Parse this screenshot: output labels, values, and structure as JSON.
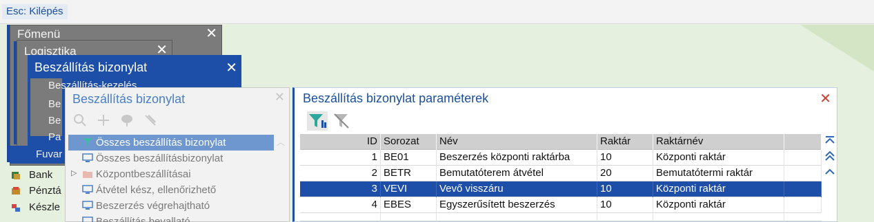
{
  "topbar": {
    "esc_label": "Esc: Kilépés"
  },
  "main_menu": {
    "title": "Főmenü"
  },
  "logistics_menu": {
    "title": "Logisztika"
  },
  "beszall_menu": {
    "title": "Beszállítás bizonylat",
    "items": [
      "Beszállítás-kezelés",
      "Be",
      "Be",
      "Pa"
    ]
  },
  "left_nav": {
    "fuvar_label": "Fuvar",
    "items": [
      {
        "label": "Bank",
        "icon": "bank-icon"
      },
      {
        "label": "Pénztá",
        "icon": "cash-icon"
      },
      {
        "label": "Készle",
        "icon": "stock-icon"
      }
    ]
  },
  "tree": {
    "title": "Beszállítás bizonylat",
    "toolbar": [
      "search-icon",
      "add-icon",
      "tree-icon",
      "pin-icon"
    ],
    "rows": [
      {
        "label": "Összes beszállítás bizonylat",
        "icon": "filter-icon",
        "selected": true
      },
      {
        "label": "Összes beszállításbizonylat",
        "icon": "screen-icon"
      },
      {
        "label": "Központbeszállításai",
        "icon": "folder-icon",
        "expandable": true
      },
      {
        "label": "Átvétel kész, ellenőrizhető",
        "icon": "screen-icon"
      },
      {
        "label": "Beszerzés végrehajtható",
        "icon": "screen-icon"
      },
      {
        "label": "Beszállítás bevallató",
        "icon": "screen-icon"
      }
    ]
  },
  "params": {
    "title": "Beszállítás bizonylat paraméterek",
    "columns": [
      "ID",
      "Sorozat",
      "Név",
      "Raktár",
      "Raktárnév"
    ],
    "rows": [
      {
        "id": "1",
        "sorozat": "BE01",
        "nev": "Beszerzés központi raktárba",
        "raktar": "10",
        "raktarnev": "Központi raktár"
      },
      {
        "id": "2",
        "sorozat": "BETR",
        "nev": "Bemutatóterem átvétel",
        "raktar": "20",
        "raktarnev": "Bemutatótermi raktár"
      },
      {
        "id": "3",
        "sorozat": "VEVI",
        "nev": "Vevő visszáru",
        "raktar": "10",
        "raktarnev": "Központi raktár"
      },
      {
        "id": "4",
        "sorozat": "EBES",
        "nev": "Egyszerűsített beszerzés",
        "raktar": "10",
        "raktarnev": "Központi raktár"
      }
    ],
    "selected_row": 2
  },
  "colors": {
    "accent": "#1d4fa8",
    "window_gray": "#7b7b7b",
    "background": "#e6f0df"
  }
}
